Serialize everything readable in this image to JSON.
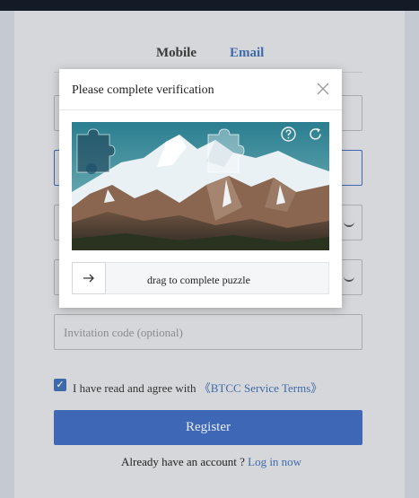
{
  "tabs": {
    "mobile": "Mobile",
    "email": "Email"
  },
  "form": {
    "invite_placeholder": "Invitation code (optional)",
    "agree_text": "I have read and agree with",
    "agree_link": "《BTCC Service Terms》",
    "register_label": "Register",
    "login_prompt": "Already have an account ?",
    "login_link": "Log in now"
  },
  "modal": {
    "title": "Please complete verification",
    "slider_hint": "drag to complete puzzle",
    "icons": {
      "close": "close-icon",
      "help": "help-icon",
      "refresh": "refresh-icon",
      "arrow": "arrow-right-icon"
    }
  },
  "colors": {
    "accent": "#3e67b6",
    "link": "#3f6aa9"
  }
}
